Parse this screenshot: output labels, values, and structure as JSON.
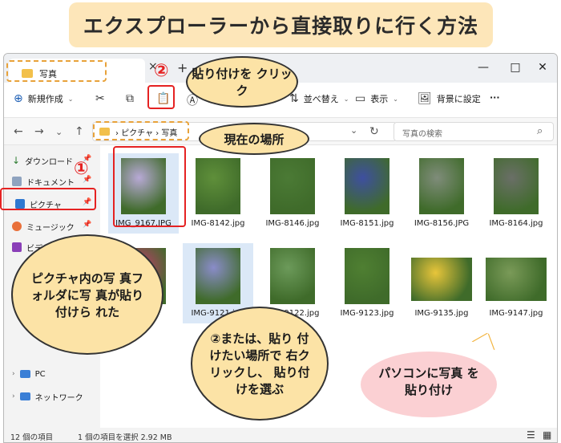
{
  "banner": {
    "title": "エクスプローラーから直接取りに行く方法"
  },
  "window": {
    "tab_label": "写真",
    "tab_close": "×",
    "tab_add": "+",
    "minimize": "—",
    "maximize": "□",
    "close": "✕"
  },
  "toolbar": {
    "new_label": "新規作成",
    "sort_label": "並べ替え",
    "view_label": "表示",
    "background_label": "背景に設定",
    "more": "···"
  },
  "address": {
    "crumb": "› ピクチャ › 写真",
    "search_placeholder": "写真の検索"
  },
  "sidebar": {
    "items": [
      {
        "label": "ダウンロード"
      },
      {
        "label": "ドキュメント"
      },
      {
        "label": "ピクチャ"
      },
      {
        "label": "ミュージック"
      },
      {
        "label": "ビデオ"
      }
    ],
    "pc": "PC",
    "network": "ネットワーク"
  },
  "files": [
    {
      "name": "IMG_9167.JPG",
      "color": "#b8a9d6"
    },
    {
      "name": "IMG-8142.jpg",
      "color": "#5f8f3a"
    },
    {
      "name": "IMG-8146.jpg",
      "color": "#4b7a35"
    },
    {
      "name": "IMG-8151.jpg",
      "color": "#3e4fa0"
    },
    {
      "name": "IMG-8156.JPG",
      "color": "#7f8c7a"
    },
    {
      "name": "IMG-8164.jpg",
      "color": "#6a6f67"
    },
    {
      "name": "jpg",
      "color": "#c23a6e"
    },
    {
      "name": "IMG-9121.jpg",
      "color": "#8a8cc9"
    },
    {
      "name": "IMG-9122.jpg",
      "color": "#6c9a5a"
    },
    {
      "name": "IMG-9123.jpg",
      "color": "#4f7f32"
    },
    {
      "name": "IMG-9135.jpg",
      "color": "#e8c53a"
    },
    {
      "name": "IMG-9147.jpg",
      "color": "#7a9a58"
    }
  ],
  "status": {
    "count": "12 個の項目",
    "selected": "1 個の項目を選択  2.92 MB"
  },
  "annotations": {
    "num1": "①",
    "num2": "②",
    "paste_bubble": "貼り付けを クリック",
    "location_bubble": "現在の場所",
    "folder_bubble": "ピクチャ内の写 真フォルダに写 真が貼り付けら れた",
    "right_click_bubble": "②または、貼り 付けたい場所で 右クリックし、 貼り付けを選ぶ",
    "pink_text": "パソコンに写真 を貼り付け"
  },
  "colors": {
    "accent_red": "#e52222",
    "banner_bg": "#fde6b9",
    "bubble_bg": "#fce3a6",
    "pink": "#fbd0d3"
  }
}
